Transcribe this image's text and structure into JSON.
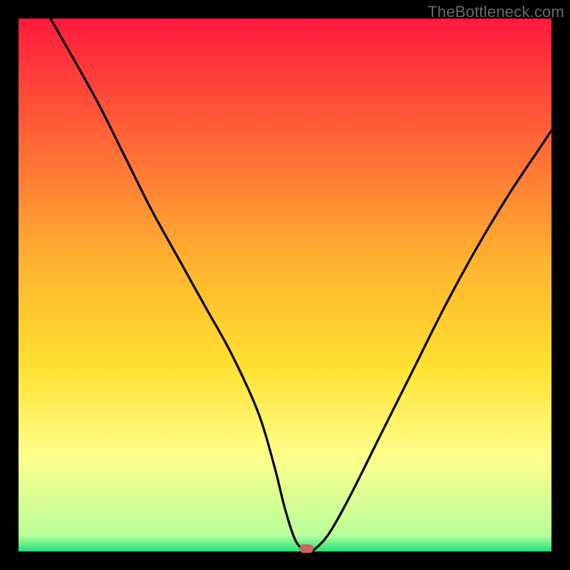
{
  "watermark": "TheBottleneck.com",
  "colors": {
    "black_border": "#000000",
    "grad_top": "#ff1a3c",
    "grad_mid": "#ffd21f",
    "grad_low": "#ffff8a",
    "grad_bottom": "#1fe07a",
    "curve": "#000000",
    "marker": "#c86662",
    "watermark_text": "#6a6a6a"
  },
  "chart_data": {
    "type": "line",
    "title": "",
    "xlabel": "",
    "ylabel": "",
    "xlim": [
      0,
      100
    ],
    "ylim": [
      0,
      100
    ],
    "background_gradient": {
      "direction": "vertical",
      "stops": [
        {
          "pos": 0,
          "color": "#ff1a3c"
        },
        {
          "pos": 45,
          "color": "#ffb030"
        },
        {
          "pos": 65,
          "color": "#ffe030"
        },
        {
          "pos": 82,
          "color": "#ffff8a"
        },
        {
          "pos": 97,
          "color": "#b8ff9a"
        },
        {
          "pos": 100,
          "color": "#1fe07a"
        }
      ]
    },
    "series": [
      {
        "name": "bottleneck-curve",
        "x": [
          6,
          10,
          15,
          20,
          25,
          30,
          35,
          40,
          45,
          48,
          50,
          52,
          54,
          55,
          58,
          62,
          68,
          74,
          80,
          86,
          92,
          98,
          100
        ],
        "y": [
          100,
          93,
          84,
          74,
          64,
          55,
          46,
          37,
          26,
          16,
          8,
          2,
          0,
          0,
          3,
          10,
          22,
          34,
          46,
          57,
          67,
          76,
          79
        ]
      }
    ],
    "annotations": [
      {
        "name": "minimum-marker",
        "x": 54,
        "y": 0.5,
        "shape": "pill",
        "color": "#c86662"
      }
    ]
  }
}
